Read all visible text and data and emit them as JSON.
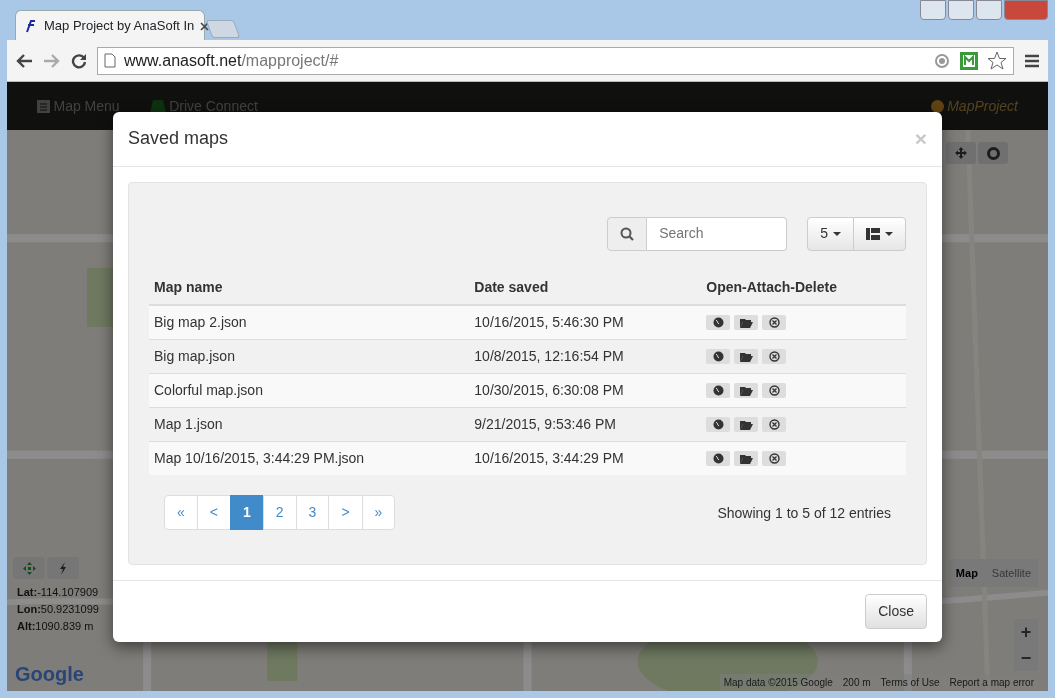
{
  "browser": {
    "tab_title": "Map Project by AnaSoft In",
    "url_host": "www.anasoft.net",
    "url_path": "/mapproject/#"
  },
  "app_nav": {
    "items": [
      "Map Menu",
      "Drive Connect"
    ],
    "brand": "MapProject"
  },
  "map": {
    "kind": "picture",
    "coords": [
      {
        "label": "Lat:",
        "value": "-114.107909"
      },
      {
        "label": "Lon:",
        "value": "50.9231099"
      },
      {
        "label": "Alt:",
        "value": "1090.839 m"
      }
    ],
    "map_types": [
      {
        "label": "Map",
        "selected": true
      },
      {
        "label": "Satellite",
        "selected": false
      }
    ],
    "zoom": [
      "+",
      "−"
    ],
    "logo": "Google",
    "attribution": [
      "Map data ©2015 Google",
      "200 m",
      "Terms of Use",
      "Report a map error"
    ]
  },
  "modal": {
    "title": "Saved maps",
    "close": "×",
    "search": {
      "placeholder": "Search"
    },
    "page_size": "5",
    "table": {
      "columns": [
        "Map name",
        "Date saved",
        "Open-Attach-Delete"
      ],
      "rows": [
        {
          "name": "Big map 2.json",
          "date": "10/16/2015, 5:46:30 PM"
        },
        {
          "name": "Big map.json",
          "date": "10/8/2015, 12:16:54 PM"
        },
        {
          "name": "Colorful map.json",
          "date": "10/30/2015, 6:30:08 PM"
        },
        {
          "name": "Map 1.json",
          "date": "9/21/2015, 9:53:46 PM"
        },
        {
          "name": "Map 10/16/2015, 3:44:29 PM.json",
          "date": "10/16/2015, 3:44:29 PM"
        }
      ]
    },
    "pagination": [
      {
        "label": "«",
        "selected": false
      },
      {
        "label": "<",
        "selected": false
      },
      {
        "label": "1",
        "selected": true
      },
      {
        "label": "2",
        "selected": false
      },
      {
        "label": "3",
        "selected": false
      },
      {
        "label": ">",
        "selected": false
      },
      {
        "label": "»",
        "selected": false
      }
    ],
    "info": "Showing 1 to 5 of 12 entries",
    "footer_button": "Close"
  }
}
